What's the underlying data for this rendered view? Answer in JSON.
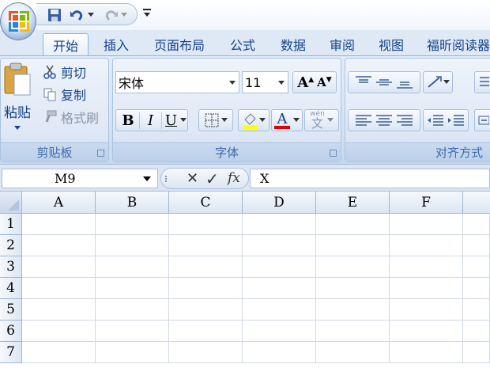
{
  "quick_access": {
    "save": "save-icon",
    "undo": "undo-icon",
    "redo": "redo-icon",
    "customize": "₹"
  },
  "tabs": [
    "开始",
    "插入",
    "页面布局",
    "公式",
    "数据",
    "审阅",
    "视图",
    "福昕阅读器"
  ],
  "active_tab": "开始",
  "clipboard": {
    "paste": "粘贴",
    "cut": "剪切",
    "copy": "复制",
    "format_painter": "格式刷",
    "group_label": "剪贴板"
  },
  "font": {
    "family": "宋体",
    "size": "11",
    "bold": "B",
    "italic": "I",
    "underline": "U",
    "font_color_glyph": "A",
    "phonetic_glyph": "wén",
    "group_label": "字体",
    "font_color": "#e00000",
    "highlight_color": "#ffff00"
  },
  "alignment": {
    "group_label": "对齐方式"
  },
  "formula_bar": {
    "name_box": "M9",
    "cancel": "✕",
    "enter": "✓",
    "fx": "fx",
    "content": "X"
  },
  "sheet": {
    "columns": [
      "A",
      "B",
      "C",
      "D",
      "E",
      "F"
    ],
    "rows": [
      "1",
      "2",
      "3",
      "4",
      "5",
      "6",
      "7"
    ]
  }
}
